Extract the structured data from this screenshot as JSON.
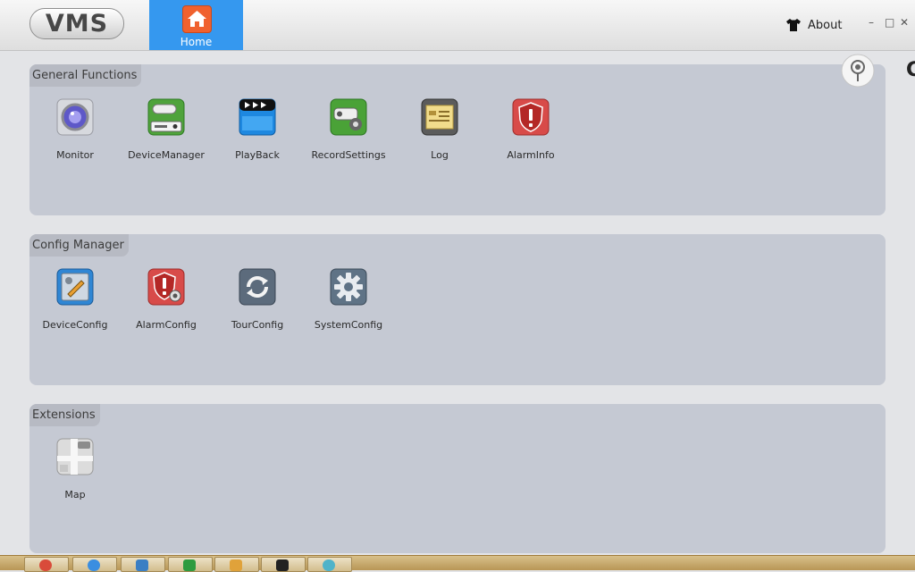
{
  "app": {
    "logo_text": "VMS",
    "home_tab_label": "Home",
    "about_label": "About",
    "window_controls": {
      "minimize": "–",
      "maximize": "□",
      "close": "✕"
    },
    "side_glyph": "C"
  },
  "sections": {
    "general": {
      "title": "General Functions",
      "items": [
        {
          "label": "Monitor",
          "icon": "monitor-icon"
        },
        {
          "label": "DeviceManager",
          "icon": "device-manager-icon"
        },
        {
          "label": "PlayBack",
          "icon": "playback-icon"
        },
        {
          "label": "RecordSettings",
          "icon": "record-settings-icon"
        },
        {
          "label": "Log",
          "icon": "log-icon"
        },
        {
          "label": "AlarmInfo",
          "icon": "alarm-info-icon"
        }
      ]
    },
    "config": {
      "title": "Config Manager",
      "items": [
        {
          "label": "DeviceConfig",
          "icon": "device-config-icon"
        },
        {
          "label": "AlarmConfig",
          "icon": "alarm-config-icon"
        },
        {
          "label": "TourConfig",
          "icon": "tour-config-icon"
        },
        {
          "label": "SystemConfig",
          "icon": "system-config-icon"
        }
      ]
    },
    "extensions": {
      "title": "Extensions",
      "items": [
        {
          "label": "Map",
          "icon": "map-icon"
        }
      ]
    }
  },
  "colors": {
    "accent": "#3598ef",
    "home_icon": "#f0612e",
    "panel_bg": "#c5c9d3",
    "page_bg": "#e3e4e7"
  },
  "taskbar": {
    "buttons": [
      "chrome-icon",
      "ie-icon",
      "explorer-icon",
      "store-icon",
      "paint-icon",
      "cmd-icon",
      "vms-icon"
    ]
  }
}
